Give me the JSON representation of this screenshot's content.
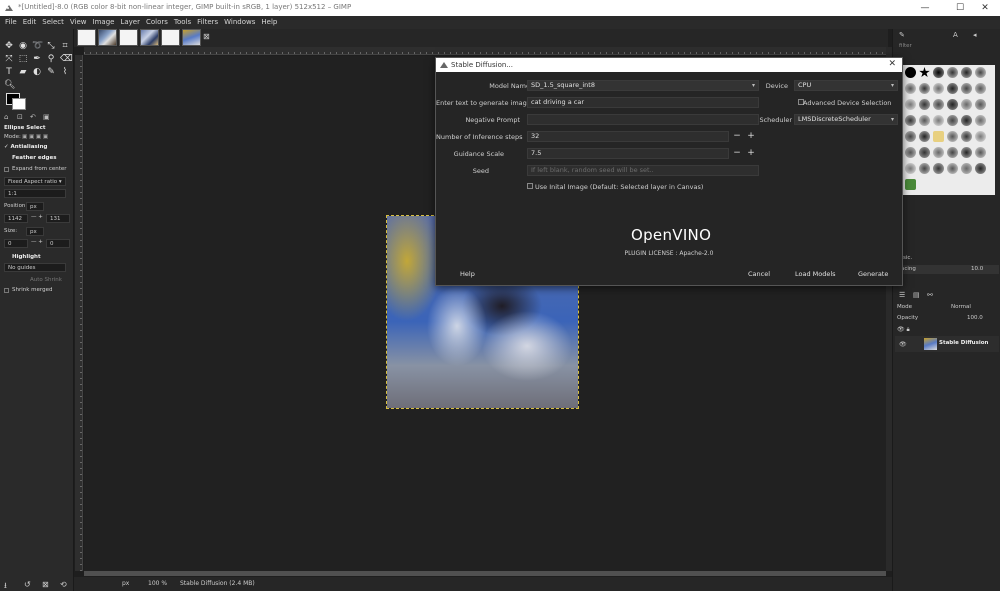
{
  "window": {
    "title": "*[Untitled]-8.0 (RGB color 8-bit non-linear integer, GIMP built-in sRGB, 1 layer) 512x512 – GIMP",
    "minimize": "—",
    "maximize": "☐",
    "close": "✕"
  },
  "menu": [
    "File",
    "Edit",
    "Select",
    "View",
    "Image",
    "Layer",
    "Colors",
    "Tools",
    "Filters",
    "Windows",
    "Help"
  ],
  "image_tabs": {
    "close_icon": "⊠"
  },
  "toolbox": {
    "tool_name": "Ellipse Select",
    "mode_label": "Mode:",
    "antialiasing": "Antialiasing",
    "feather_edges": "Feather edges",
    "expand_from_center": "Expand from center",
    "fixed_label": "Fixed Aspect ratio",
    "ratio": "1:1",
    "position_label": "Position:",
    "position_unit": "px",
    "position_x": "1142",
    "position_y": "131",
    "size_label": "Size:",
    "size_unit": "px",
    "size_w": "0",
    "size_h": "0",
    "highlight": "Highlight",
    "guides": "No guides",
    "auto_shrink": "Auto Shrink",
    "shrink_merged": "Shrink merged"
  },
  "statusbar": {
    "unit": "px",
    "zoom": "100 %",
    "info": "Stable Diffusion (2.4 MB)"
  },
  "right_dock": {
    "filter_placeholder": "filter",
    "brush_set": "sic.",
    "spacing_label": "acing",
    "spacing_value": "10.0",
    "mode_label": "Mode",
    "mode_value": "Normal",
    "opacity_label": "Opacity",
    "opacity_value": "100.0",
    "layer_name": "Stable Diffusion"
  },
  "dialog": {
    "title": "Stable Diffusion...",
    "model_name_label": "Model Name",
    "model_name_value": "SD_1.5_square_int8",
    "device_label": "Device",
    "device_value": "CPU",
    "prompt_label": "Enter text to generate image",
    "prompt_value": "cat driving a car",
    "advanced_label": "Advanced Device Selection",
    "negative_label": "Negative Prompt",
    "negative_value": "",
    "scheduler_label": "Scheduler",
    "scheduler_value": "LMSDiscreteScheduler",
    "steps_label": "Number of Inference steps",
    "steps_value": "32",
    "guidance_label": "Guidance Scale",
    "guidance_value": "7.5",
    "seed_label": "Seed",
    "seed_placeholder": "If left blank, random seed will be set..",
    "initial_image_label": "Use Inital Image (Default: Selected layer in Canvas)",
    "logo_text": "OpenVINO",
    "license": "PLUGIN LICENSE : Apache-2.0",
    "help": "Help",
    "cancel": "Cancel",
    "load_models": "Load Models",
    "generate": "Generate"
  }
}
